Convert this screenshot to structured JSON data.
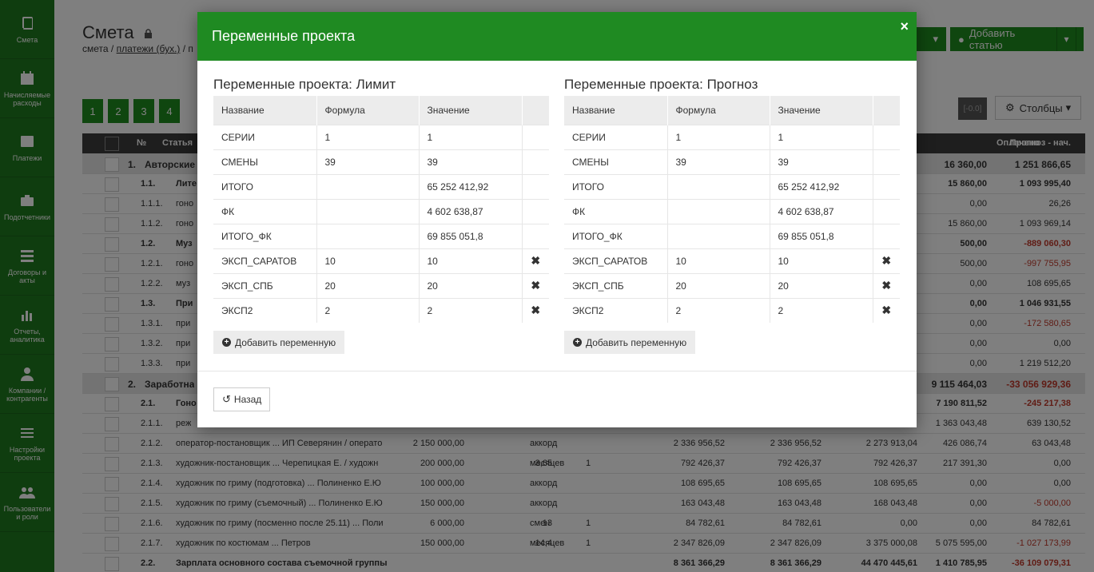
{
  "sidebar": {
    "items": [
      {
        "label": "Смета",
        "icon": "book-icon"
      },
      {
        "label": "Начисляемые расходы",
        "icon": "calendar-icon"
      },
      {
        "label": "Платежи",
        "icon": "list-icon"
      },
      {
        "label": "Подотчетники",
        "icon": "briefcase-icon"
      },
      {
        "label": "Договоры и акты",
        "icon": "list-lines-icon"
      },
      {
        "label": "Отчеты, аналитика",
        "icon": "bar-chart-icon"
      },
      {
        "label": "Компании / контрагенты",
        "icon": "user-icon"
      },
      {
        "label": "Настройки проекта",
        "icon": "sliders-icon"
      },
      {
        "label": "Пользователи и роли",
        "icon": "users-icon"
      }
    ]
  },
  "page": {
    "title": "Смета",
    "breadcrumb": {
      "first": "смета",
      "sep": "/",
      "link": "платежи (бух.)",
      "tail": "/ п"
    },
    "add_article": "Добавить статью",
    "pages": [
      "1",
      "2",
      "3",
      "4"
    ],
    "columns_button": "Столбцы",
    "mini_button": "[-0.0]",
    "head": {
      "num": "№",
      "article": "Статья",
      "paid": "Оплачено",
      "forecast": "Прогноз - нач."
    },
    "rows": [
      {
        "type": "group",
        "num": "1.",
        "name": "Авторские",
        "paid": "16 360,00",
        "forecast": "1 251 866,65",
        "neg": false
      },
      {
        "type": "sub",
        "num": "1.1.",
        "name": "Лите",
        "paid": "15 860,00",
        "forecast": "1 093 995,40",
        "neg": false
      },
      {
        "type": "row",
        "num": "1.1.1.",
        "name": "гоно",
        "paid": "0,00",
        "forecast": "26,26",
        "neg": false
      },
      {
        "type": "row",
        "num": "1.1.2.",
        "name": "гоно",
        "paid": "15 860,00",
        "forecast": "1 093 969,14",
        "neg": false
      },
      {
        "type": "sub",
        "num": "1.2.",
        "name": "Муз",
        "paid": "500,00",
        "forecast": "-889 060,30",
        "neg": true
      },
      {
        "type": "row",
        "num": "1.2.1.",
        "name": "гоно",
        "paid": "500,00",
        "forecast": "-997 755,95",
        "neg": true
      },
      {
        "type": "row",
        "num": "1.2.2.",
        "name": "муз",
        "paid": "0,00",
        "forecast": "108 695,65",
        "neg": false
      },
      {
        "type": "sub",
        "num": "1.3.",
        "name": "При",
        "paid": "0,00",
        "forecast": "1 046 931,55",
        "neg": false
      },
      {
        "type": "row",
        "num": "1.3.1.",
        "name": "при",
        "paid": "0,00",
        "forecast": "-172 580,65",
        "neg": true
      },
      {
        "type": "row",
        "num": "1.3.2.",
        "name": "при",
        "paid": "0,00",
        "forecast": "0,00",
        "neg": false
      },
      {
        "type": "row",
        "num": "1.3.3.",
        "name": "при",
        "paid": "0,00",
        "forecast": "1 219 512,20",
        "neg": false
      },
      {
        "type": "group",
        "num": "2.",
        "name": "Заработна",
        "paid": "9 115 464,03",
        "forecast": "-33 056 929,36",
        "neg": true
      },
      {
        "type": "sub",
        "num": "2.1.",
        "name": "Гоно",
        "paid": "7 190 811,52",
        "forecast": "-245 217,38",
        "neg": true
      },
      {
        "type": "row",
        "num": "2.1.1.",
        "name": "реж",
        "paid": "1 363 043,48",
        "forecast": "639 130,52",
        "neg": false
      },
      {
        "type": "row",
        "num": "2.1.2.",
        "name": "оператор-постановщик ... ИП Северянин / операто",
        "limit": "2 150 000,00",
        "qty": "",
        "unit": "аккорд",
        "cnt": "",
        "a": "2 336 956,52",
        "b": "2 336 956,52",
        "c": "2 273 913,04",
        "paid": "426 086,74",
        "forecast": "63 043,48",
        "neg": false
      },
      {
        "type": "row",
        "num": "2.1.3.",
        "name": "художник-постановщик ... Черепицкая Е. / художн",
        "limit": "200 000,00",
        "qty": "3,65",
        "unit": "месяцев",
        "cnt": "1",
        "a": "792 426,37",
        "b": "792 426,37",
        "c": "792 426,37",
        "paid": "217 391,30",
        "forecast": "0,00",
        "neg": false
      },
      {
        "type": "row",
        "num": "2.1.4.",
        "name": "художник по гриму (подготовка) ... Полиненко Е.Ю",
        "limit": "100 000,00",
        "qty": "",
        "unit": "аккорд",
        "cnt": "",
        "a": "108 695,65",
        "b": "108 695,65",
        "c": "108 695,65",
        "paid": "0,00",
        "forecast": "0,00",
        "neg": false
      },
      {
        "type": "row",
        "num": "2.1.5.",
        "name": "художник по гриму (съемочный) ... Полиненко Е.Ю",
        "limit": "150 000,00",
        "qty": "",
        "unit": "аккорд",
        "cnt": "",
        "a": "163 043,48",
        "b": "163 043,48",
        "c": "168 043,48",
        "paid": "0,00",
        "forecast": "-5 000,00",
        "neg": true
      },
      {
        "type": "row",
        "num": "2.1.6.",
        "name": "художник по гриму (посменно после 25.11) ... Поли",
        "limit": "6 000,00",
        "qty": "13",
        "unit": "смен",
        "cnt": "1",
        "a": "84 782,61",
        "b": "84 782,61",
        "c": "0,00",
        "paid": "0,00",
        "forecast": "84 782,61",
        "neg": false
      },
      {
        "type": "row",
        "num": "2.1.7.",
        "name": "художник по костюмам ... Петров",
        "limit": "150 000,00",
        "qty": "14,4",
        "unit": "месяцев",
        "cnt": "1",
        "a": "2 347 826,09",
        "b": "2 347 826,09",
        "c": "3 375 000,08",
        "paid": "5 075 595,00",
        "forecast": "-1 027 173,99",
        "neg": true
      },
      {
        "type": "sub",
        "num": "2.2.",
        "name": "Зарплата основного состава съемочной группы",
        "a": "8 361 366,29",
        "b": "8 361 366,29",
        "c": "44 470 445,61",
        "paid": "1 410 785,95",
        "forecast": "-36 109 079,31",
        "neg": true
      }
    ]
  },
  "modal": {
    "title": "Переменные проекта",
    "close": "×",
    "headers": {
      "name": "Название",
      "formula": "Формула",
      "value": "Значение"
    },
    "limit": {
      "title": "Переменные проекта: Лимит",
      "rows": [
        {
          "name": "СЕРИИ",
          "formula": "1",
          "value": "1",
          "deletable": false
        },
        {
          "name": "СМЕНЫ",
          "formula": "39",
          "value": "39",
          "deletable": false
        },
        {
          "name": "ИТОГО",
          "formula": "",
          "value": "65 252 412,92",
          "deletable": false
        },
        {
          "name": "ФК",
          "formula": "",
          "value": "4 602 638,87",
          "deletable": false
        },
        {
          "name": "ИТОГО_ФК",
          "formula": "",
          "value": "69 855 051,8",
          "deletable": false
        },
        {
          "name": "ЭКСП_САРАТОВ",
          "formula": "10",
          "value": "10",
          "deletable": true
        },
        {
          "name": "ЭКСП_СПБ",
          "formula": "20",
          "value": "20",
          "deletable": true
        },
        {
          "name": "ЭКСП2",
          "formula": "2",
          "value": "2",
          "deletable": true
        }
      ],
      "add_label": "Добавить переменную"
    },
    "forecast": {
      "title": "Переменные проекта: Прогноз",
      "rows": [
        {
          "name": "СЕРИИ",
          "formula": "1",
          "value": "1",
          "deletable": false
        },
        {
          "name": "СМЕНЫ",
          "formula": "39",
          "value": "39",
          "deletable": false
        },
        {
          "name": "ИТОГО",
          "formula": "",
          "value": "65 252 412,92",
          "deletable": false
        },
        {
          "name": "ФК",
          "formula": "",
          "value": "4 602 638,87",
          "deletable": false
        },
        {
          "name": "ИТОГО_ФК",
          "formula": "",
          "value": "69 855 051,8",
          "deletable": false
        },
        {
          "name": "ЭКСП_САРАТОВ",
          "formula": "10",
          "value": "10",
          "deletable": true
        },
        {
          "name": "ЭКСП_СПБ",
          "formula": "20",
          "value": "20",
          "deletable": true
        },
        {
          "name": "ЭКСП2",
          "formula": "2",
          "value": "2",
          "deletable": true
        }
      ],
      "add_label": "Добавить переменную"
    },
    "delete_glyph": "✖",
    "back_label": "Назад"
  }
}
